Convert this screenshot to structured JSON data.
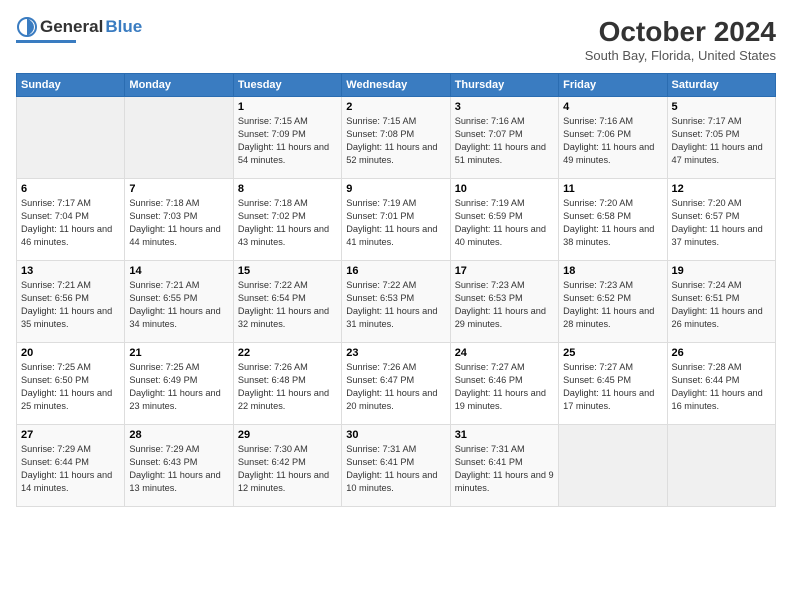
{
  "logo": {
    "general": "General",
    "blue": "Blue"
  },
  "title": "October 2024",
  "location": "South Bay, Florida, United States",
  "days_header": [
    "Sunday",
    "Monday",
    "Tuesday",
    "Wednesday",
    "Thursday",
    "Friday",
    "Saturday"
  ],
  "weeks": [
    [
      {
        "day": "",
        "info": ""
      },
      {
        "day": "",
        "info": ""
      },
      {
        "day": "1",
        "info": "Sunrise: 7:15 AM\nSunset: 7:09 PM\nDaylight: 11 hours and 54 minutes."
      },
      {
        "day": "2",
        "info": "Sunrise: 7:15 AM\nSunset: 7:08 PM\nDaylight: 11 hours and 52 minutes."
      },
      {
        "day": "3",
        "info": "Sunrise: 7:16 AM\nSunset: 7:07 PM\nDaylight: 11 hours and 51 minutes."
      },
      {
        "day": "4",
        "info": "Sunrise: 7:16 AM\nSunset: 7:06 PM\nDaylight: 11 hours and 49 minutes."
      },
      {
        "day": "5",
        "info": "Sunrise: 7:17 AM\nSunset: 7:05 PM\nDaylight: 11 hours and 47 minutes."
      }
    ],
    [
      {
        "day": "6",
        "info": "Sunrise: 7:17 AM\nSunset: 7:04 PM\nDaylight: 11 hours and 46 minutes."
      },
      {
        "day": "7",
        "info": "Sunrise: 7:18 AM\nSunset: 7:03 PM\nDaylight: 11 hours and 44 minutes."
      },
      {
        "day": "8",
        "info": "Sunrise: 7:18 AM\nSunset: 7:02 PM\nDaylight: 11 hours and 43 minutes."
      },
      {
        "day": "9",
        "info": "Sunrise: 7:19 AM\nSunset: 7:01 PM\nDaylight: 11 hours and 41 minutes."
      },
      {
        "day": "10",
        "info": "Sunrise: 7:19 AM\nSunset: 6:59 PM\nDaylight: 11 hours and 40 minutes."
      },
      {
        "day": "11",
        "info": "Sunrise: 7:20 AM\nSunset: 6:58 PM\nDaylight: 11 hours and 38 minutes."
      },
      {
        "day": "12",
        "info": "Sunrise: 7:20 AM\nSunset: 6:57 PM\nDaylight: 11 hours and 37 minutes."
      }
    ],
    [
      {
        "day": "13",
        "info": "Sunrise: 7:21 AM\nSunset: 6:56 PM\nDaylight: 11 hours and 35 minutes."
      },
      {
        "day": "14",
        "info": "Sunrise: 7:21 AM\nSunset: 6:55 PM\nDaylight: 11 hours and 34 minutes."
      },
      {
        "day": "15",
        "info": "Sunrise: 7:22 AM\nSunset: 6:54 PM\nDaylight: 11 hours and 32 minutes."
      },
      {
        "day": "16",
        "info": "Sunrise: 7:22 AM\nSunset: 6:53 PM\nDaylight: 11 hours and 31 minutes."
      },
      {
        "day": "17",
        "info": "Sunrise: 7:23 AM\nSunset: 6:53 PM\nDaylight: 11 hours and 29 minutes."
      },
      {
        "day": "18",
        "info": "Sunrise: 7:23 AM\nSunset: 6:52 PM\nDaylight: 11 hours and 28 minutes."
      },
      {
        "day": "19",
        "info": "Sunrise: 7:24 AM\nSunset: 6:51 PM\nDaylight: 11 hours and 26 minutes."
      }
    ],
    [
      {
        "day": "20",
        "info": "Sunrise: 7:25 AM\nSunset: 6:50 PM\nDaylight: 11 hours and 25 minutes."
      },
      {
        "day": "21",
        "info": "Sunrise: 7:25 AM\nSunset: 6:49 PM\nDaylight: 11 hours and 23 minutes."
      },
      {
        "day": "22",
        "info": "Sunrise: 7:26 AM\nSunset: 6:48 PM\nDaylight: 11 hours and 22 minutes."
      },
      {
        "day": "23",
        "info": "Sunrise: 7:26 AM\nSunset: 6:47 PM\nDaylight: 11 hours and 20 minutes."
      },
      {
        "day": "24",
        "info": "Sunrise: 7:27 AM\nSunset: 6:46 PM\nDaylight: 11 hours and 19 minutes."
      },
      {
        "day": "25",
        "info": "Sunrise: 7:27 AM\nSunset: 6:45 PM\nDaylight: 11 hours and 17 minutes."
      },
      {
        "day": "26",
        "info": "Sunrise: 7:28 AM\nSunset: 6:44 PM\nDaylight: 11 hours and 16 minutes."
      }
    ],
    [
      {
        "day": "27",
        "info": "Sunrise: 7:29 AM\nSunset: 6:44 PM\nDaylight: 11 hours and 14 minutes."
      },
      {
        "day": "28",
        "info": "Sunrise: 7:29 AM\nSunset: 6:43 PM\nDaylight: 11 hours and 13 minutes."
      },
      {
        "day": "29",
        "info": "Sunrise: 7:30 AM\nSunset: 6:42 PM\nDaylight: 11 hours and 12 minutes."
      },
      {
        "day": "30",
        "info": "Sunrise: 7:31 AM\nSunset: 6:41 PM\nDaylight: 11 hours and 10 minutes."
      },
      {
        "day": "31",
        "info": "Sunrise: 7:31 AM\nSunset: 6:41 PM\nDaylight: 11 hours and 9 minutes."
      },
      {
        "day": "",
        "info": ""
      },
      {
        "day": "",
        "info": ""
      }
    ]
  ]
}
